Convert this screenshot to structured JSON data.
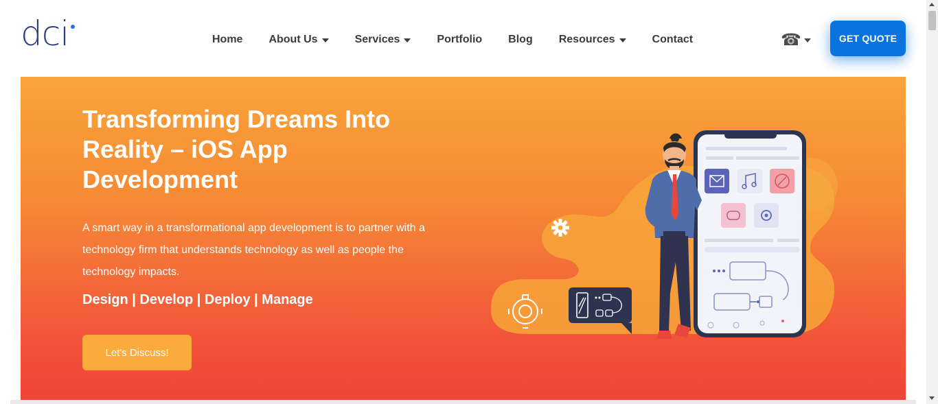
{
  "brand": {
    "logo_text": "dci",
    "accent": "#0b73e0"
  },
  "nav": {
    "items": [
      {
        "label": "Home",
        "dropdown": false
      },
      {
        "label": "About Us",
        "dropdown": true
      },
      {
        "label": "Services",
        "dropdown": true
      },
      {
        "label": "Portfolio",
        "dropdown": false
      },
      {
        "label": "Blog",
        "dropdown": false
      },
      {
        "label": "Resources",
        "dropdown": true
      },
      {
        "label": "Contact",
        "dropdown": false
      }
    ],
    "phone_icon": "☎",
    "cta_label": "GET QUOTE"
  },
  "hero": {
    "title": "Transforming Dreams Into Reality – iOS App Development",
    "description": "A smart way in a transformational app development is to partner with a technology firm that understands technology as well as people the technology impacts.",
    "tagline": "Design | Develop | Deploy | Manage",
    "cta_label": "Let's Discuss!",
    "gradient_top": "#f9a43a",
    "gradient_bottom": "#f04438"
  },
  "illustration": {
    "name": "ios-developer-illustration",
    "icons": [
      "gear-icon",
      "mail-icon",
      "music-icon",
      "compass-icon",
      "gamepad-icon",
      "settings-icon",
      "phone-icon",
      "flowchart-icon"
    ]
  }
}
